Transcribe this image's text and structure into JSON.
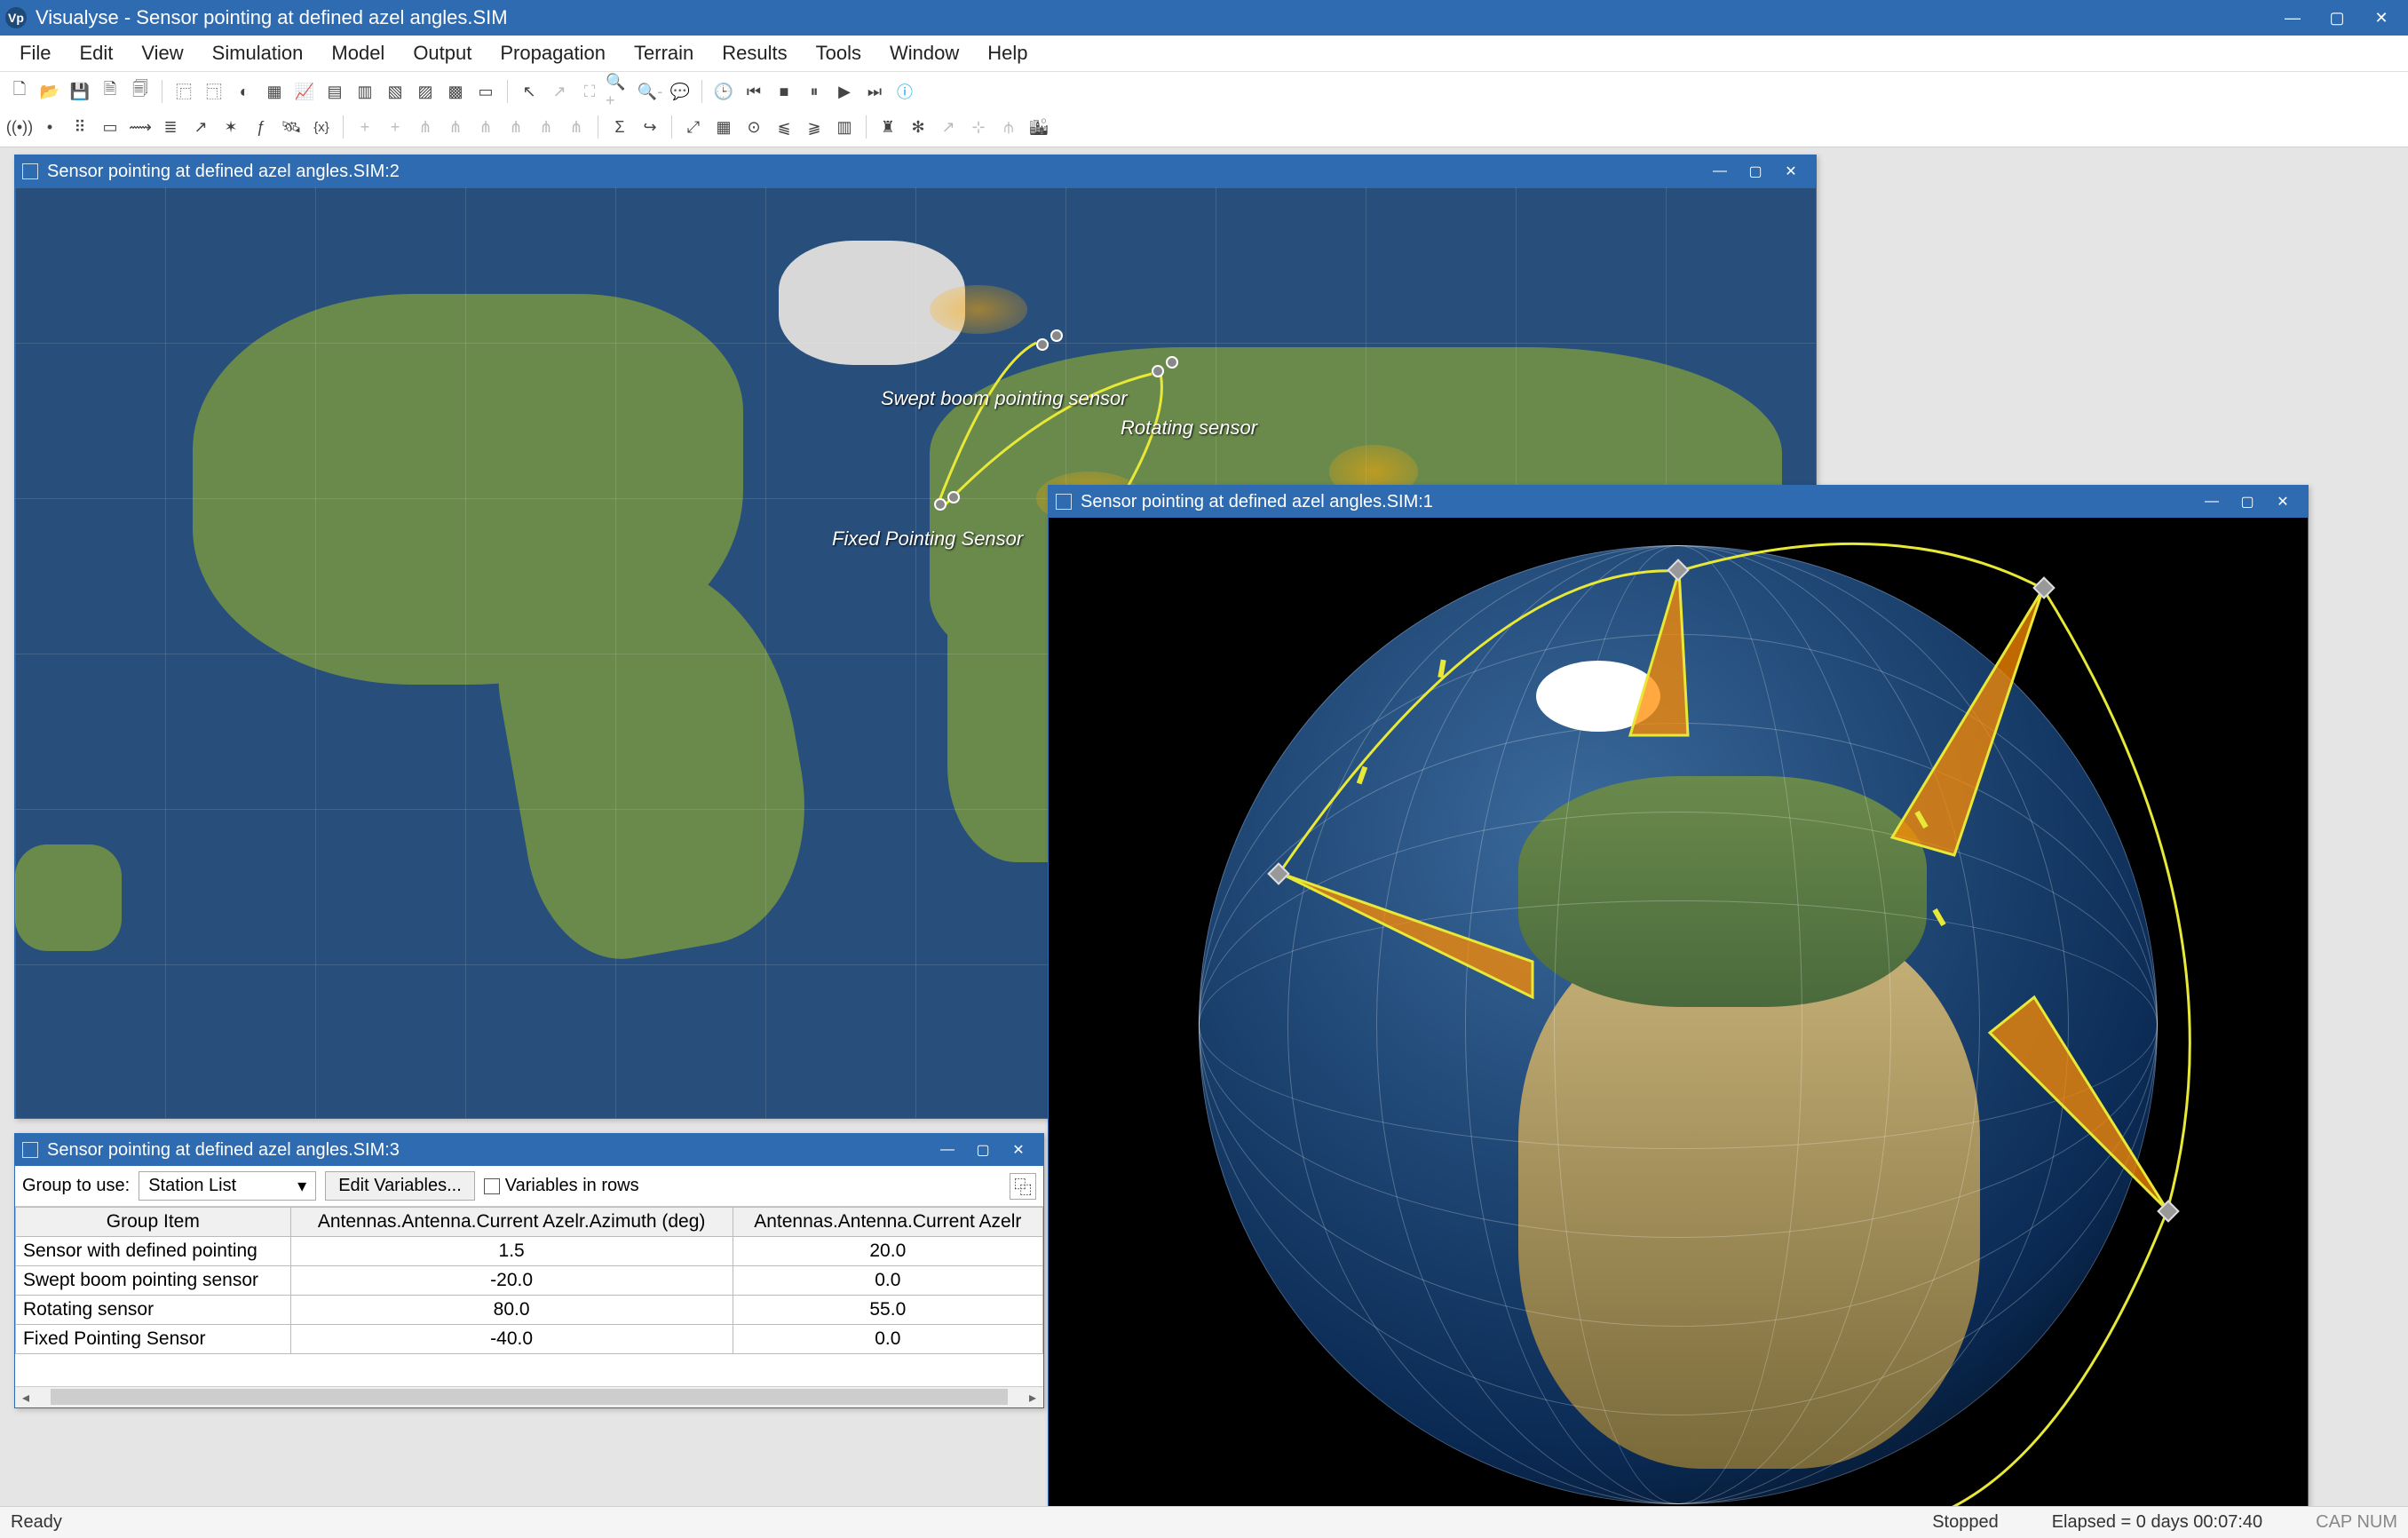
{
  "app": {
    "title": "Visualyse - Sensor pointing at defined azel angles.SIM",
    "logo_text": "Vp"
  },
  "menus": [
    "File",
    "Edit",
    "View",
    "Simulation",
    "Model",
    "Output",
    "Propagation",
    "Terrain",
    "Results",
    "Tools",
    "Window",
    "Help"
  ],
  "subwindows": {
    "map": {
      "title": "Sensor pointing at defined azel angles.SIM:2"
    },
    "globe": {
      "title": "Sensor pointing at defined azel angles.SIM:1"
    },
    "table": {
      "title": "Sensor pointing at defined azel angles.SIM:3"
    }
  },
  "map_labels": {
    "swept": "Swept boom pointing sensor",
    "rotating": "Rotating sensor",
    "fixed": "Fixed Pointing Sensor"
  },
  "table_toolbar": {
    "group_label": "Group to use:",
    "group_value": "Station List",
    "edit_btn": "Edit Variables...",
    "vars_rows": "Variables in rows"
  },
  "table": {
    "headers": [
      "Group Item",
      "Antennas.Antenna.Current Azelr.Azimuth (deg)",
      "Antennas.Antenna.Current Azelr"
    ],
    "rows": [
      {
        "item": "Sensor with defined pointing",
        "az": "1.5",
        "el": "20.0"
      },
      {
        "item": "Swept boom pointing sensor",
        "az": "-20.0",
        "el": "0.0"
      },
      {
        "item": "Rotating sensor",
        "az": "80.0",
        "el": "55.0"
      },
      {
        "item": "Fixed Pointing Sensor",
        "az": "-40.0",
        "el": "0.0"
      }
    ]
  },
  "status": {
    "left": "Ready",
    "mid": "Stopped",
    "elapsed": "Elapsed = 0 days 00:07:40",
    "caps": "CAP NUM"
  },
  "chart_data": {
    "type": "table",
    "title": "Sensor pointing at defined azel angles",
    "columns": [
      "Group Item",
      "Antennas.Antenna.Current Azelr.Azimuth (deg)",
      "Antennas.Antenna.Current Azelr.Elevation (deg)"
    ],
    "rows": [
      [
        "Sensor with defined pointing",
        1.5,
        20.0
      ],
      [
        "Swept boom pointing sensor",
        -20.0,
        0.0
      ],
      [
        "Rotating sensor",
        80.0,
        55.0
      ],
      [
        "Fixed Pointing Sensor",
        -40.0,
        0.0
      ]
    ]
  }
}
